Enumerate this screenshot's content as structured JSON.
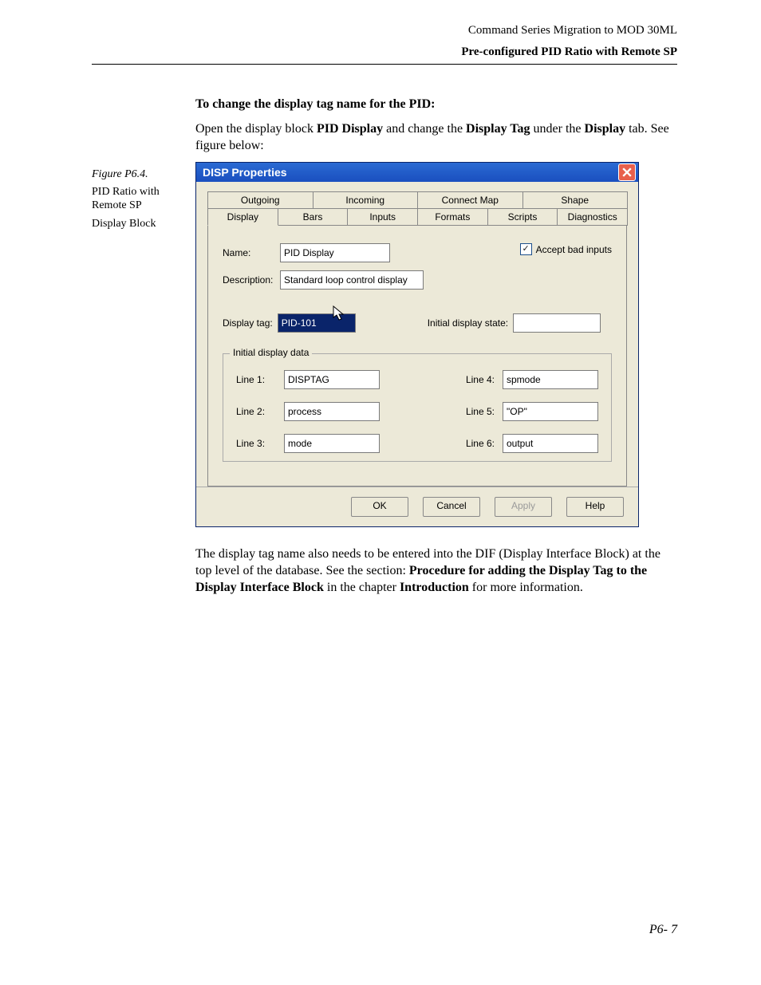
{
  "header": {
    "running_title": "Command Series Migration to MOD 30ML",
    "section_title": "Pre-configured PID Ratio with Remote SP"
  },
  "body": {
    "heading": "To change the display tag name for the PID:",
    "para1_pre": "Open the display block ",
    "para1_b1": "PID Display",
    "para1_mid1": " and change the ",
    "para1_b2": "Display Tag",
    "para1_mid2": " under the ",
    "para1_b3": "Display",
    "para1_post": " tab. See figure below:",
    "para2_pre": "The display tag name also needs to be entered into the DIF (Display Interface Block) at the top level of the database. See the section: ",
    "para2_b1": "Procedure for adding the Display Tag to the Display Interface Block",
    "para2_mid": " in the chapter ",
    "para2_b2": "Introduction",
    "para2_post": " for more information."
  },
  "side": {
    "figlabel": "Figure P6.4.",
    "line1": "PID Ratio with Remote SP",
    "line2": "Display Block"
  },
  "dialog": {
    "title": "DISP Properties",
    "tabs_row1": [
      "Outgoing",
      "Incoming",
      "Connect Map",
      "Shape"
    ],
    "tabs_row2": [
      "Display",
      "Bars",
      "Inputs",
      "Formats",
      "Scripts",
      "Diagnostics"
    ],
    "labels": {
      "name": "Name:",
      "description": "Description:",
      "accept_bad": "Accept bad inputs",
      "display_tag": "Display tag:",
      "initial_state": "Initial display state:",
      "legend": "Initial display data",
      "line1": "Line 1:",
      "line2": "Line 2:",
      "line3": "Line 3:",
      "line4": "Line 4:",
      "line5": "Line 5:",
      "line6": "Line 6:"
    },
    "values": {
      "name": "PID Display",
      "description": "Standard loop control display",
      "display_tag": "PID-101",
      "initial_state": "",
      "line1": "DISPTAG",
      "line2": "process",
      "line3": "mode",
      "line4": "spmode",
      "line5": "\"OP\"",
      "line6": "output",
      "accept_bad_checked": "✓"
    },
    "buttons": {
      "ok": "OK",
      "cancel": "Cancel",
      "apply": "Apply",
      "help": "Help"
    }
  },
  "page_number": "P6- 7"
}
